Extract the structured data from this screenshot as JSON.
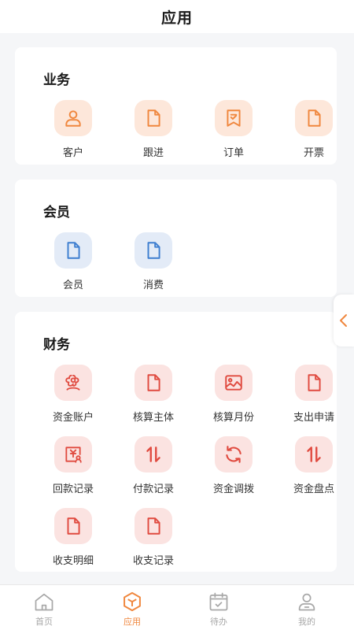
{
  "header": {
    "title": "应用"
  },
  "sections": {
    "business": {
      "title": "业务",
      "items": [
        {
          "label": "客户",
          "icon": "customer-icon",
          "tone": "orange"
        },
        {
          "label": "跟进",
          "icon": "document-icon",
          "tone": "orange"
        },
        {
          "label": "订单",
          "icon": "order-icon",
          "tone": "orange"
        },
        {
          "label": "开票",
          "icon": "document-icon",
          "tone": "orange"
        }
      ]
    },
    "member": {
      "title": "会员",
      "items": [
        {
          "label": "会员",
          "icon": "document-icon",
          "tone": "blue"
        },
        {
          "label": "消费",
          "icon": "document-icon",
          "tone": "blue"
        }
      ]
    },
    "finance": {
      "title": "财务",
      "items": [
        {
          "label": "资金账户",
          "icon": "flower-icon",
          "tone": "red"
        },
        {
          "label": "核算主体",
          "icon": "document-icon",
          "tone": "red"
        },
        {
          "label": "核算月份",
          "icon": "image-icon",
          "tone": "red"
        },
        {
          "label": "支出申请",
          "icon": "document-icon",
          "tone": "red"
        },
        {
          "label": "回款记录",
          "icon": "payment-return-icon",
          "tone": "red"
        },
        {
          "label": "付款记录",
          "icon": "transfer-arrows-icon",
          "tone": "red"
        },
        {
          "label": "资金调拨",
          "icon": "refresh-icon",
          "tone": "red"
        },
        {
          "label": "资金盘点",
          "icon": "transfer-arrows-icon",
          "tone": "red"
        },
        {
          "label": "收支明细",
          "icon": "document-icon",
          "tone": "red"
        },
        {
          "label": "收支记录",
          "icon": "document-icon",
          "tone": "red"
        }
      ]
    }
  },
  "tabbar": {
    "tabs": [
      {
        "label": "首页",
        "icon": "home-icon",
        "active": false
      },
      {
        "label": "应用",
        "icon": "apps-cube-icon",
        "active": true
      },
      {
        "label": "待办",
        "icon": "calendar-check-icon",
        "active": false
      },
      {
        "label": "我的",
        "icon": "profile-icon",
        "active": false
      }
    ]
  },
  "colors": {
    "accent": "#f0873e",
    "business_icon": "#f0873e",
    "member_icon": "#3f7fd0",
    "finance_icon": "#e04b40",
    "tab_inactive": "#a8a8a8"
  }
}
